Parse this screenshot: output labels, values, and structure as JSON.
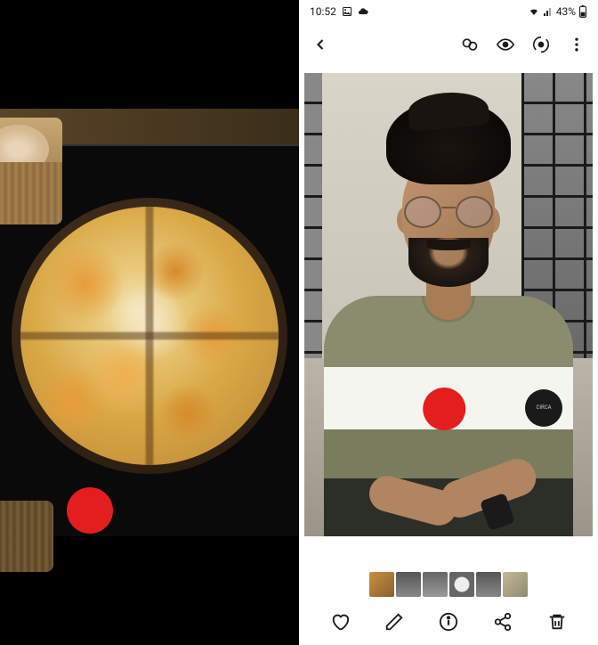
{
  "status_bar": {
    "time": "10:52",
    "battery_percent": "43%"
  },
  "icons": {
    "image_status": "image-icon",
    "cloud_status": "cloud-icon",
    "wifi": "wifi-icon",
    "signal": "signal-icon",
    "battery": "battery-icon",
    "back": "back-icon",
    "remaster": "remaster-icon",
    "vision": "eye-icon",
    "lens": "bixby-vision-icon",
    "more": "more-icon",
    "favorite": "heart-icon",
    "edit": "pencil-icon",
    "details": "info-icon",
    "share": "share-icon",
    "delete": "trash-icon"
  },
  "badge": {
    "text": "CIRCA"
  },
  "markers": {
    "red_dot_color": "#e41e1e"
  },
  "thumbnails": {
    "count": 6
  }
}
